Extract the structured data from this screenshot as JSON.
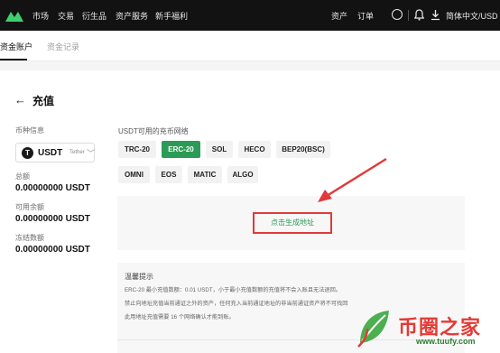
{
  "topbar": {
    "nav": [
      "市场",
      "交易",
      "衍生品",
      "资产服务",
      "新手福利"
    ],
    "assets": "资产",
    "orders": "订单",
    "language": "简体中文/USD"
  },
  "subnav": {
    "tabs": [
      "资金账户",
      "资金记录"
    ]
  },
  "page": {
    "back": "←",
    "title": "充值"
  },
  "left": {
    "coin_info_label": "币种信息",
    "coin": {
      "symbol_glyph": "T",
      "name": "USDT",
      "sub": "Tether",
      "chevron": "﹀"
    },
    "total_label": "总额",
    "total_value": "0.00000000 USDT",
    "available_label": "可用余额",
    "available_value": "0.00000000 USDT",
    "frozen_label": "冻结数额",
    "frozen_value": "0.00000000 USDT"
  },
  "network": {
    "title": "USDT可用的充币网络",
    "chips": [
      "TRC-20",
      "ERC-20",
      "SOL",
      "HECO",
      "BEP20(BSC)",
      "OMNI",
      "EOS",
      "MATIC",
      "ALGO"
    ],
    "active": "ERC-20",
    "generate_label": "点击生成地址"
  },
  "tips": {
    "title": "温馨提示",
    "lines": [
      "ERC-20 最小充值数额：0.01 USDT，小于最小充值数额的充值将不会入账且无法退回。",
      "禁止向地址充值当前通证之外的资产，任何充入当前通证地址的非当前通证资产将不可找回",
      "此用地址充值需要 16 个网络确认才能到账。"
    ]
  },
  "watermark": {
    "brand": "币圈之家",
    "url": "www.tuufy.com"
  },
  "colors": {
    "accent_green": "#2c9b56",
    "highlight_red": "#e03a3a",
    "topbar_bg": "#121212"
  }
}
